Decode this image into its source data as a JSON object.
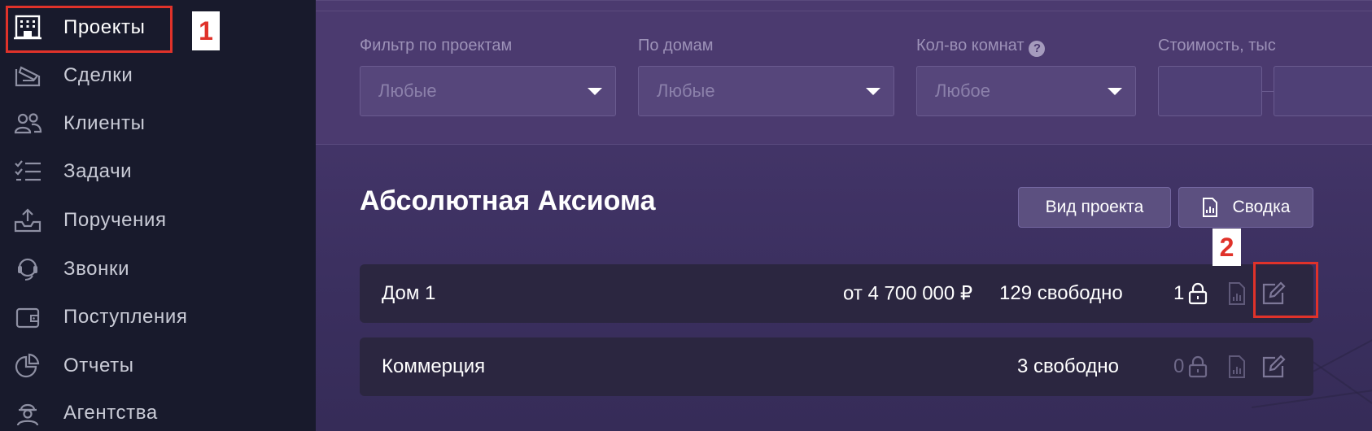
{
  "sidebar": {
    "items": [
      {
        "label": "Проекты",
        "icon": "building-icon",
        "active": true
      },
      {
        "label": "Сделки",
        "icon": "deal-icon"
      },
      {
        "label": "Клиенты",
        "icon": "users-icon"
      },
      {
        "label": "Задачи",
        "icon": "tasks-icon"
      },
      {
        "label": "Поручения",
        "icon": "inbox-upload-icon"
      },
      {
        "label": "Звонки",
        "icon": "headset-icon"
      },
      {
        "label": "Поступления",
        "icon": "wallet-icon"
      },
      {
        "label": "Отчеты",
        "icon": "pie-chart-icon"
      },
      {
        "label": "Агентства",
        "icon": "agent-icon"
      }
    ]
  },
  "annotations": {
    "marker1": "1",
    "marker2": "2",
    "color": "#e0322a"
  },
  "filters": {
    "projects": {
      "label": "Фильтр по проектам",
      "value": "Любые"
    },
    "houses": {
      "label": "По домам",
      "value": "Любые"
    },
    "rooms": {
      "label": "Кол-во комнат",
      "value": "Любое",
      "help": "?"
    },
    "cost": {
      "label": "Стоимость, тыс"
    }
  },
  "project": {
    "title": "Абсолютная Аксиома",
    "view_button": "Вид проекта",
    "summary_button": "Сводка",
    "houses": [
      {
        "name": "Дом 1",
        "price": "от 4 700 000 ₽",
        "free": "129 свободно",
        "locked": "1"
      },
      {
        "name": "Коммерция",
        "price": "",
        "free": "3 свободно",
        "locked": "0"
      }
    ]
  },
  "colors": {
    "sidebar_bg": "#181a2c",
    "main_bg": "#423467",
    "row_bg": "#2b2640",
    "accent_red": "#e0322a"
  }
}
